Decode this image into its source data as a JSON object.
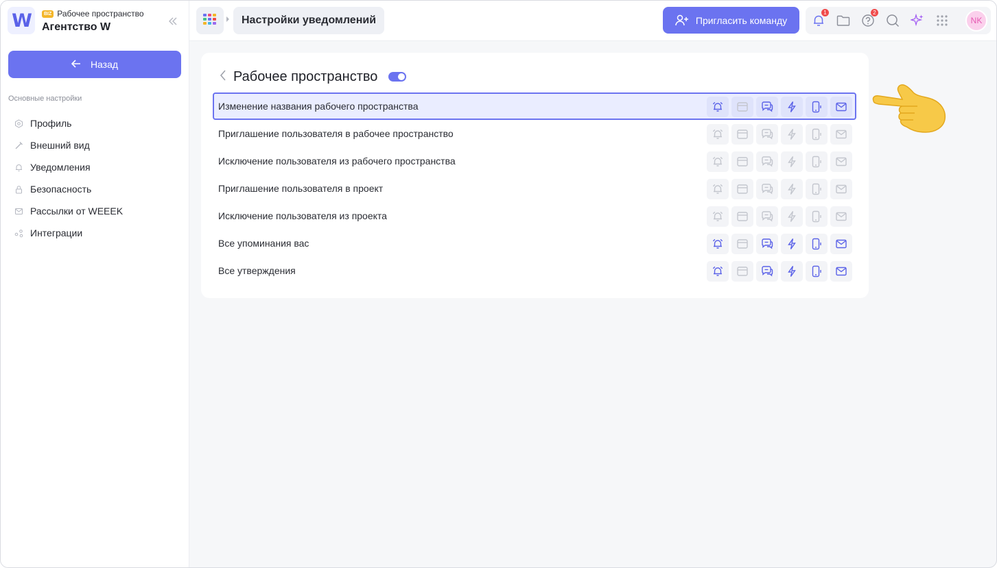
{
  "sidebar": {
    "badge": "BIZ",
    "workspace_type": "Рабочее пространство",
    "workspace_name": "Агентство W",
    "logo_letter": "W",
    "back_label": "Назад",
    "section_title": "Основные настройки",
    "items": [
      {
        "label": "Профиль",
        "icon": "hexagon-icon"
      },
      {
        "label": "Внешний вид",
        "icon": "brush-icon"
      },
      {
        "label": "Уведомления",
        "icon": "bell-icon"
      },
      {
        "label": "Безопасность",
        "icon": "lock-icon"
      },
      {
        "label": "Рассылки от WEEEK",
        "icon": "mail-icon"
      },
      {
        "label": "Интеграции",
        "icon": "integrations-icon"
      }
    ]
  },
  "topbar": {
    "breadcrumb_current": "Настройки уведомлений",
    "invite_label": "Пригласить команду",
    "notifications_count": "1",
    "help_count": "2",
    "avatar_initials": "NK"
  },
  "card": {
    "title": "Рабочее пространство",
    "toggle_on": true,
    "channels": [
      "bell-icon",
      "browser-icon",
      "chat-icon",
      "lightning-icon",
      "phone-icon",
      "mail-icon"
    ],
    "rows": [
      {
        "label": "Изменение названия рабочего пространства",
        "enabled": [
          true,
          false,
          true,
          true,
          true,
          true
        ],
        "selected": true
      },
      {
        "label": "Приглашение пользователя в рабочее пространство",
        "enabled": [
          false,
          false,
          false,
          false,
          false,
          false
        ],
        "selected": false
      },
      {
        "label": "Исключение пользователя из рабочего пространства",
        "enabled": [
          false,
          false,
          false,
          false,
          false,
          false
        ],
        "selected": false
      },
      {
        "label": "Приглашение пользователя в проект",
        "enabled": [
          false,
          false,
          false,
          false,
          false,
          false
        ],
        "selected": false
      },
      {
        "label": "Исключение пользователя из проекта",
        "enabled": [
          false,
          false,
          false,
          false,
          false,
          false
        ],
        "selected": false
      },
      {
        "label": "Все упоминания вас",
        "enabled": [
          true,
          false,
          true,
          true,
          true,
          true
        ],
        "selected": false
      },
      {
        "label": "Все утверждения",
        "enabled": [
          true,
          false,
          true,
          true,
          true,
          true
        ],
        "selected": false
      }
    ]
  },
  "colors": {
    "accent": "#6b73f0",
    "active_icon": "#5b62e8",
    "inactive_icon": "#c3c6ce"
  }
}
